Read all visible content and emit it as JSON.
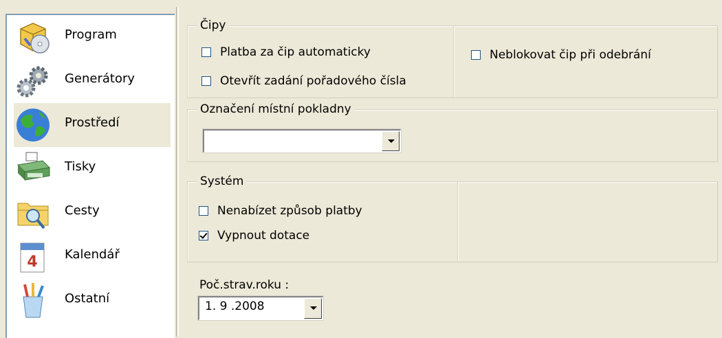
{
  "nav": {
    "items": [
      {
        "label": "Program",
        "icon": "program-icon"
      },
      {
        "label": "Generátory",
        "icon": "gears-icon"
      },
      {
        "label": "Prostředí",
        "icon": "globe-icon",
        "selected": true
      },
      {
        "label": "Tisky",
        "icon": "printer-icon"
      },
      {
        "label": "Cesty",
        "icon": "folder-search-icon"
      },
      {
        "label": "Kalendář",
        "icon": "calendar-icon"
      },
      {
        "label": "Ostatní",
        "icon": "brushes-icon"
      }
    ]
  },
  "chips": {
    "title": "Čipy",
    "auto_payment": {
      "label": "Platba za čip automaticky",
      "checked": false
    },
    "open_order_number": {
      "label": "Otevřít zadání pořadového čísla",
      "checked": false
    },
    "no_block_on_removal": {
      "label": "Neblokovat čip při odebrání",
      "checked": false
    }
  },
  "cash_register": {
    "title": "Označení místní pokladny",
    "value": ""
  },
  "system": {
    "title": "Systém",
    "no_payment_method": {
      "label": "Nenabízet způsob platby",
      "checked": false
    },
    "disable_subsidies": {
      "label": "Vypnout dotace",
      "checked": true
    }
  },
  "year_start": {
    "label": "Poč.strav.roku :",
    "value": "1. 9 .2008"
  }
}
